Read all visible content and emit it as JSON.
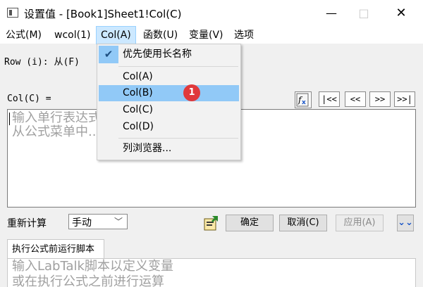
{
  "window": {
    "title": "设置值 - [Book1]Sheet1!Col(C)",
    "min_glyph": "—",
    "max_glyph": "□",
    "close_glyph": "✕"
  },
  "menubar": {
    "items": [
      "公式(M)",
      "wcol(1)",
      "Col(A)",
      "函数(U)",
      "变量(V)",
      "选项"
    ],
    "active": "Col(A)"
  },
  "dropdown": {
    "items": [
      {
        "label": "优先使用长名称",
        "checked": true
      },
      {
        "label": "Col(A)"
      },
      {
        "label": "Col(B)",
        "highlighted": true
      },
      {
        "label": "Col(C)"
      },
      {
        "label": "Col(D)"
      },
      {
        "label": "列浏览器..."
      }
    ],
    "check_glyph": "✔",
    "badge": "1"
  },
  "row_label": "Row (i): 从(F)",
  "col_label": "Col(C) =",
  "nav_buttons": [
    "|<<",
    "<<",
    ">>",
    ">>|"
  ],
  "formula": {
    "placeholder": "输入单行表达式...\n从公式菜单中..."
  },
  "recalc": {
    "label": "重新计算",
    "value": "手动",
    "arrow_glyph": "﹀"
  },
  "buttons": {
    "ok": "确定",
    "cancel": "取消(C)",
    "apply": "应用(A)",
    "expand": "⌄⌄"
  },
  "script_tab": {
    "label": "执行公式前运行脚本"
  },
  "script": {
    "placeholder": "输入LabTalk脚本以定义变量\n或在执行公式之前进行运算"
  },
  "colors": {
    "highlight": "#91c9f7",
    "badge": "#e0393b",
    "menu_active": "#cce8ff"
  },
  "icons": {
    "app": "app-window-icon",
    "fx": "function-builder-icon",
    "tool": "code-builder-icon",
    "check": "checkmark-icon"
  }
}
